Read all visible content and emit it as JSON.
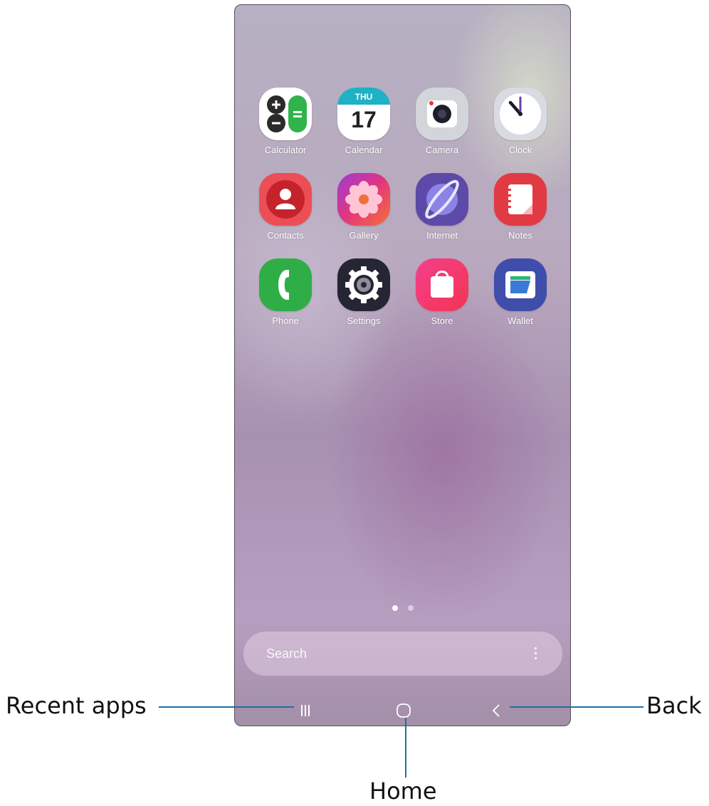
{
  "apps": [
    {
      "label": "Calculator",
      "icon": "calculator-icon"
    },
    {
      "label": "Calendar",
      "icon": "calendar-icon",
      "weekday": "THU",
      "day": "17"
    },
    {
      "label": "Camera",
      "icon": "camera-icon"
    },
    {
      "label": "Clock",
      "icon": "clock-icon"
    },
    {
      "label": "Contacts",
      "icon": "contacts-icon"
    },
    {
      "label": "Gallery",
      "icon": "gallery-icon"
    },
    {
      "label": "Internet",
      "icon": "internet-icon"
    },
    {
      "label": "Notes",
      "icon": "notes-icon"
    },
    {
      "label": "Phone",
      "icon": "phone-icon"
    },
    {
      "label": "Settings",
      "icon": "settings-icon"
    },
    {
      "label": "Store",
      "icon": "store-icon"
    },
    {
      "label": "Wallet",
      "icon": "wallet-icon"
    }
  ],
  "page_indicator": {
    "pages": 2,
    "current": 1
  },
  "search": {
    "placeholder": "Search"
  },
  "navbar": {
    "recent": {
      "icon": "recent-apps-icon"
    },
    "home": {
      "icon": "home-icon"
    },
    "back": {
      "icon": "back-icon"
    }
  },
  "callouts": {
    "recent_apps": "Recent apps",
    "home": "Home",
    "back": "Back"
  },
  "colors": {
    "callout_line": "#1d6fa5"
  }
}
